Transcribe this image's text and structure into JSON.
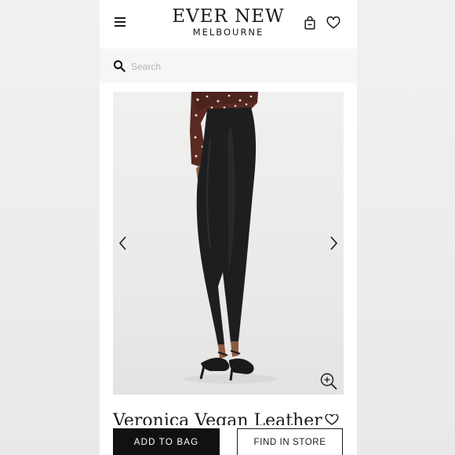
{
  "brand": {
    "name": "EVER NEW",
    "subtitle": "MELBOURNE"
  },
  "header": {
    "menu_icon": "hamburger-menu-icon",
    "bag_icon": "shopping-bag-icon",
    "wishlist_icon": "heart-icon"
  },
  "search": {
    "placeholder": "Search",
    "value": "",
    "icon": "search-icon"
  },
  "gallery": {
    "prev_icon": "chevron-left-icon",
    "next_icon": "chevron-right-icon",
    "zoom_icon": "zoom-in-icon"
  },
  "product": {
    "title_partial": "Veronica Vegan Leather",
    "wishlist_icon": "heart-outline-icon"
  },
  "actions": {
    "add_to_bag": "ADD TO BAG",
    "find_in_store": "FIND IN STORE"
  }
}
